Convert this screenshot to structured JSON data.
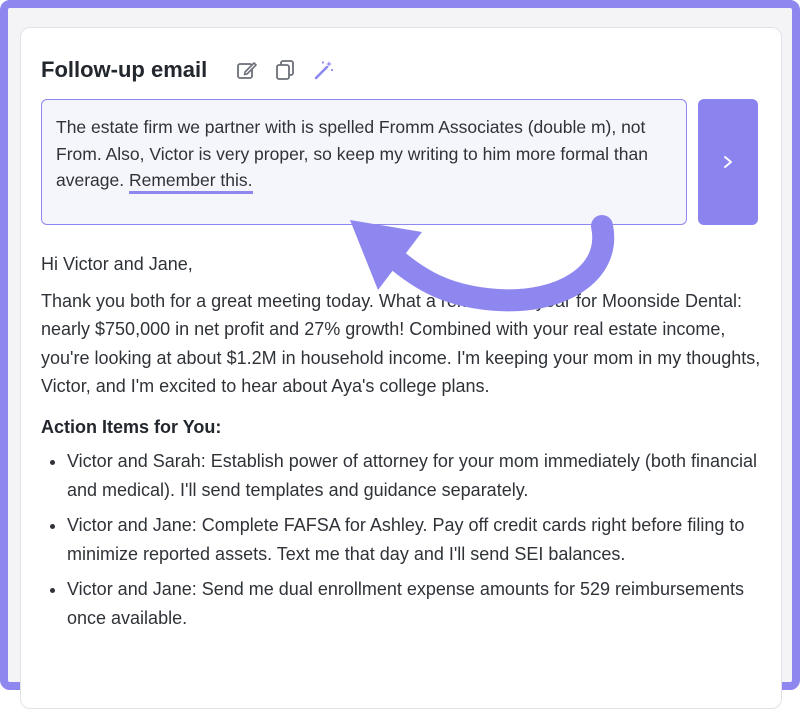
{
  "header": {
    "title": "Follow-up email",
    "icons": [
      "edit-icon",
      "copy-icon",
      "magic-wand-icon"
    ]
  },
  "prompt": {
    "text": "The estate firm we partner with is spelled Fromm Associates (double m), not From. Also, Victor is very proper, so keep my writing to him more formal than average.",
    "highlight": "Remember this.",
    "send_icon": "chevron-right-icon"
  },
  "email": {
    "greeting": "Hi Victor and Jane,",
    "body": "Thank you both for a great meeting today. What a remarkable year for Moonside Dental: nearly $750,000 in net profit and 27% growth! Combined with your real estate income, you're looking at about $1.2M in household income. I'm keeping your mom in my thoughts, Victor, and I'm excited to hear about Aya's college plans.",
    "action_heading": "Action Items for You:",
    "action_items": [
      "Victor and Sarah: Establish power of attorney for your mom immediately (both financial and medical). I'll send templates and guidance separately.",
      "Victor and Jane: Complete FAFSA for Ashley. Pay off credit cards right before filing to minimize reported assets. Text me that day and I'll send SEI balances.",
      "Victor and Jane: Send me dual enrollment expense amounts for 529 reimbursements once available."
    ]
  },
  "colors": {
    "accent": "#8e87f0",
    "send_button": "#8b84ee",
    "text": "#2f3338"
  }
}
